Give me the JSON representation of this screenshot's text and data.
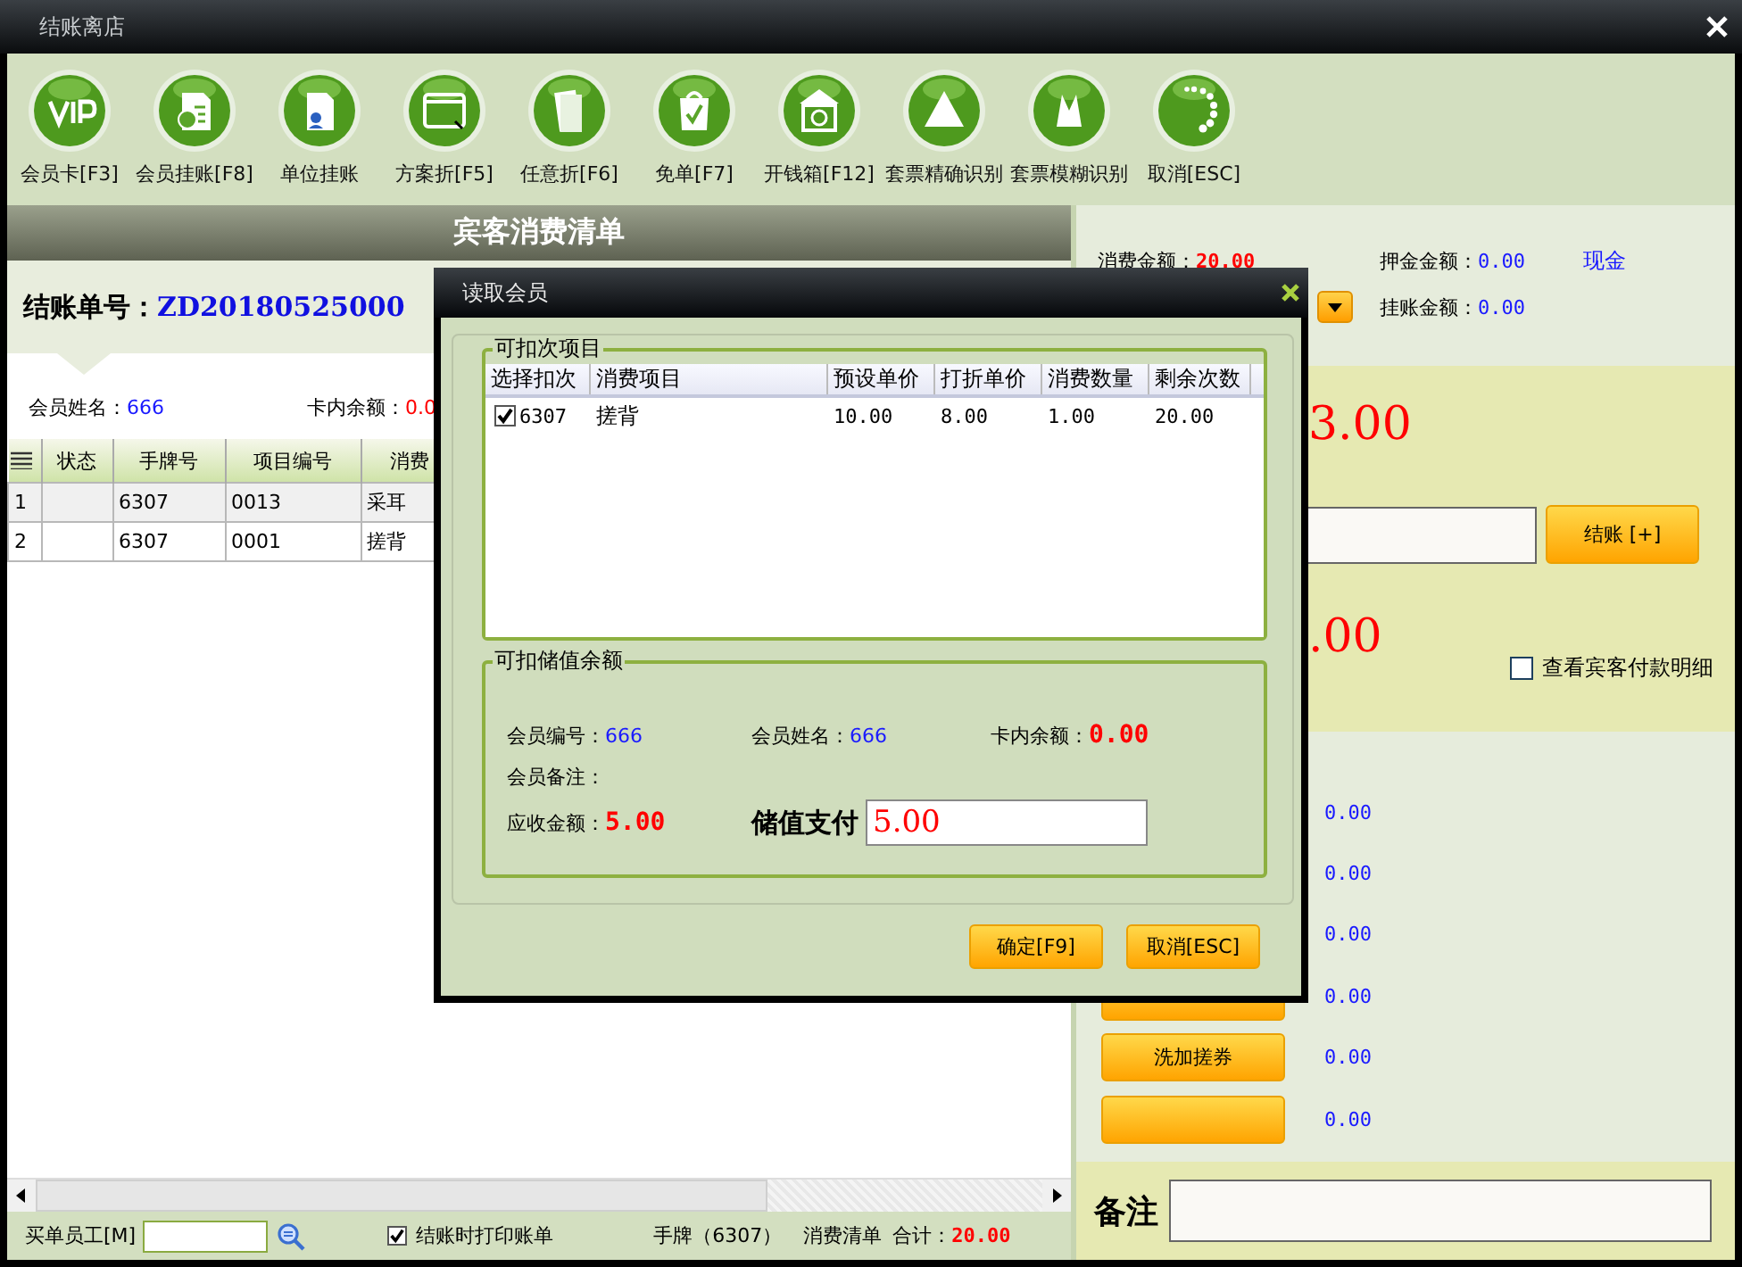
{
  "window": {
    "title": "结账离店"
  },
  "toolbar": [
    {
      "label": "会员卡[F3]"
    },
    {
      "label": "会员挂账[F8]"
    },
    {
      "label": "单位挂账"
    },
    {
      "label": "方案折[F5]"
    },
    {
      "label": "任意折[F6]"
    },
    {
      "label": "免单[F7]"
    },
    {
      "label": "开钱箱[F12]"
    },
    {
      "label": "套票精确识别"
    },
    {
      "label": "套票模糊识别"
    },
    {
      "label": "取消[ESC]"
    }
  ],
  "bill_panel": {
    "header": "宾客消费清单",
    "bill_no_label": "结账单号：",
    "bill_no": "ZD20180525000",
    "member_name_label": "会员姓名：",
    "member_name": "666",
    "balance_label": "卡内余额：",
    "balance": "0.0",
    "table": {
      "columns": [
        "",
        "状态",
        "手牌号",
        "项目编号",
        "消费"
      ],
      "rows": [
        {
          "cells": [
            "1",
            "",
            "6307",
            "0013",
            "采耳"
          ]
        },
        {
          "cells": [
            "2",
            "",
            "6307",
            "0001",
            "搓背"
          ]
        }
      ]
    }
  },
  "footer": {
    "staff_label": "买单员工[M]",
    "print_on_checkout": {
      "label": "结账时打印账单",
      "checked": true
    },
    "tag": "手牌（6307）",
    "list_label": "消费清单",
    "total_label": "合计：",
    "total": "20.00"
  },
  "summary": {
    "consumption_label": "消费金额：",
    "consumption": "20.00",
    "deposit_label": "押金金额：",
    "deposit": "0.00",
    "payment_method": "现金",
    "credit_label": "挂账金额：",
    "credit": "0.00",
    "amount_due": "3.00",
    "checkout_button": "结账 [+]",
    "change": ".00",
    "show_payment_details": {
      "label": "查看宾客付款明细",
      "checked": false
    },
    "payments": [
      {
        "button": false,
        "value": "0.00"
      },
      {
        "button": false,
        "value": "0.00"
      },
      {
        "button": false,
        "value": "0.00"
      },
      {
        "button": true,
        "value": "0.00"
      },
      {
        "button": true,
        "button_label": "洗加搓券",
        "value": "0.00"
      },
      {
        "button": true,
        "value": "0.00"
      }
    ],
    "remark_label": "备注"
  },
  "dialog": {
    "title": "读取会员",
    "items_group": {
      "legend": "可扣次项目",
      "columns": [
        "选择扣次",
        "消费项目",
        "预设单价",
        "打折单价",
        "消费数量",
        "剩余次数"
      ],
      "rows": [
        {
          "checked": true,
          "cells": [
            "6307",
            "搓背",
            "10.00",
            "8.00",
            "1.00",
            "20.00"
          ]
        }
      ]
    },
    "balance_group": {
      "legend": "可扣储值余额",
      "member_no_label": "会员编号：",
      "member_no": "666",
      "member_name_label": "会员姓名：",
      "member_name": "666",
      "balance_label": "卡内余额：",
      "balance": "0.00",
      "remark_label": "会员备注：",
      "due_label": "应收金额：",
      "due": "5.00",
      "pay_label": "储值支付",
      "pay_value": "5.00"
    },
    "buttons": [
      "确定[F9]",
      "取消[ESC]"
    ]
  }
}
